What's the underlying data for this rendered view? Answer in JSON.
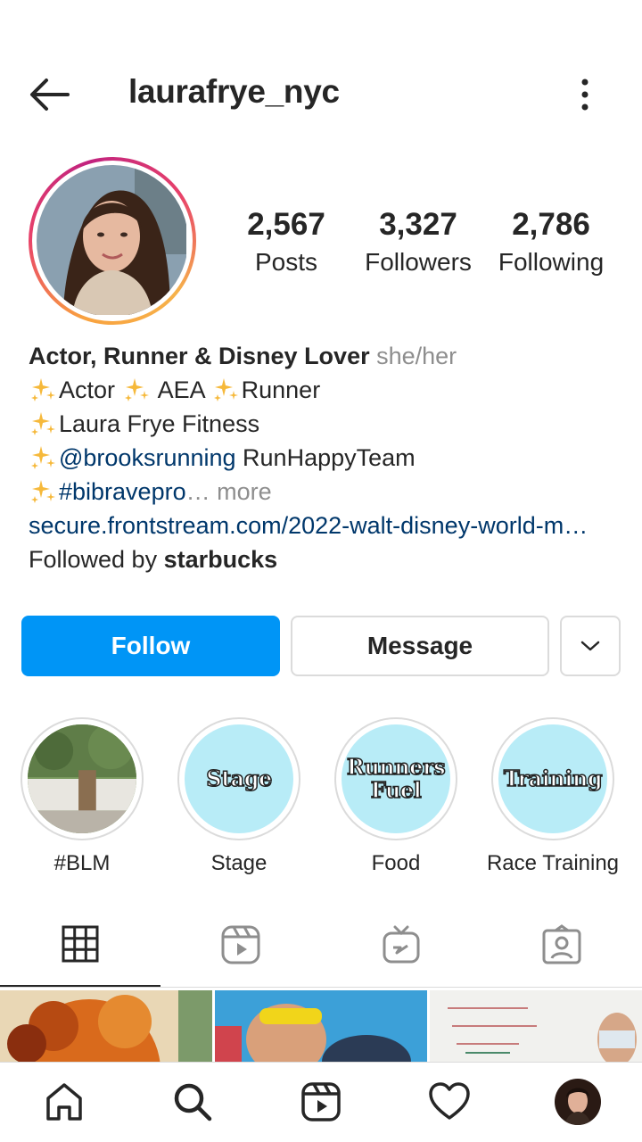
{
  "header": {
    "username": "laurafrye_nyc",
    "back_icon": "arrow-left-icon",
    "more_icon": "more-vertical-icon"
  },
  "stats": [
    {
      "value": "2,567",
      "label": "Posts"
    },
    {
      "value": "3,327",
      "label": "Followers"
    },
    {
      "value": "2,786",
      "label": "Following"
    }
  ],
  "bio": {
    "name": "Actor, Runner & Disney Lover",
    "pronouns": "she/her",
    "line1": {
      "a": "Actor",
      "b": "AEA",
      "c": "Runner"
    },
    "line2": "Laura Frye Fitness",
    "line3": {
      "mention": "@brooksrunning",
      "text": "RunHappyTeam"
    },
    "line4": {
      "hashtag": "#bibravepro",
      "ellipsis": "…",
      "more": "more"
    },
    "website": "secure.frontstream.com/2022-walt-disney-world-m…",
    "followed_by_prefix": "Followed by",
    "followed_by_user": "starbucks"
  },
  "actions": {
    "follow": "Follow",
    "message": "Message"
  },
  "highlights": [
    {
      "label": "#BLM",
      "cover_text": ""
    },
    {
      "label": "Stage",
      "cover_text": "Stage"
    },
    {
      "label": "Food",
      "cover_text_1": "Runners",
      "cover_text_2": "Fuel"
    },
    {
      "label": "Race Training",
      "cover_text": "Training"
    }
  ],
  "tabs": [
    "grid-icon",
    "reels-icon",
    "igtv-icon",
    "tagged-icon"
  ],
  "bottom_nav": [
    "home-icon",
    "search-icon",
    "reels-icon",
    "heart-icon",
    "profile-avatar"
  ],
  "colors": {
    "accent": "#0095f6",
    "link": "#00376b",
    "muted": "#8e8e8e",
    "highlight_bg": "#b8ecf7"
  }
}
